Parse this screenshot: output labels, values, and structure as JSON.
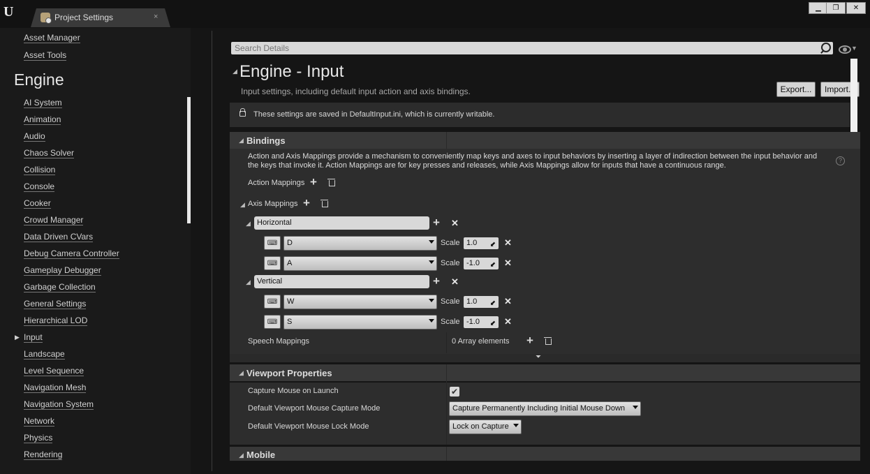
{
  "window": {
    "tab_title": "Project Settings",
    "tab_close": "×",
    "controls": [
      "▁",
      "❐",
      "✕"
    ]
  },
  "sidebar": {
    "partial_top": "Asset Manager",
    "asset_tools": "Asset Tools",
    "section": "Engine",
    "items": [
      "AI System",
      "Animation",
      "Audio",
      "Chaos Solver",
      "Collision",
      "Console",
      "Cooker",
      "Crowd Manager",
      "Data Driven CVars",
      "Debug Camera Controller",
      "Gameplay Debugger",
      "Garbage Collection",
      "General Settings",
      "Hierarchical LOD",
      "Input",
      "Landscape",
      "Level Sequence",
      "Navigation Mesh",
      "Navigation System",
      "Network",
      "Physics",
      "Rendering"
    ],
    "selected": "Input"
  },
  "search": {
    "placeholder": "Search Details"
  },
  "page": {
    "title": "Engine - Input",
    "description": "Input settings, including default input action and axis bindings.",
    "export_label": "Export...",
    "import_label": "Import..."
  },
  "notice": {
    "text": "These settings are saved in DefaultInput.ini, which is currently writable."
  },
  "bindings": {
    "title": "Bindings",
    "description": "Action and Axis Mappings provide a mechanism to conveniently map keys and axes to input behaviors by inserting a layer of indirection between the input behavior and the keys that invoke it. Action Mappings are for key presses and releases, while Axis Mappings allow for inputs that have a continuous range.",
    "help": "?",
    "action_mappings_label": "Action Mappings",
    "axis_mappings_label": "Axis Mappings",
    "scale_label": "Scale",
    "axes": [
      {
        "name": "Horizontal",
        "keys": [
          {
            "key": "D",
            "scale": "1.0"
          },
          {
            "key": "A",
            "scale": "-1.0"
          }
        ]
      },
      {
        "name": "Vertical",
        "keys": [
          {
            "key": "W",
            "scale": "1.0"
          },
          {
            "key": "S",
            "scale": "-1.0"
          }
        ]
      }
    ],
    "speech_mappings_label": "Speech Mappings",
    "speech_mappings_value": "0 Array elements"
  },
  "viewport": {
    "title": "Viewport Properties",
    "capture_mouse_label": "Capture Mouse on Launch",
    "capture_mouse_checked": true,
    "capture_mode_label": "Default Viewport Mouse Capture Mode",
    "capture_mode_value": "Capture Permanently Including Initial Mouse Down",
    "lock_mode_label": "Default Viewport Mouse Lock Mode",
    "lock_mode_value": "Lock on Capture"
  },
  "mobile": {
    "title": "Mobile"
  }
}
